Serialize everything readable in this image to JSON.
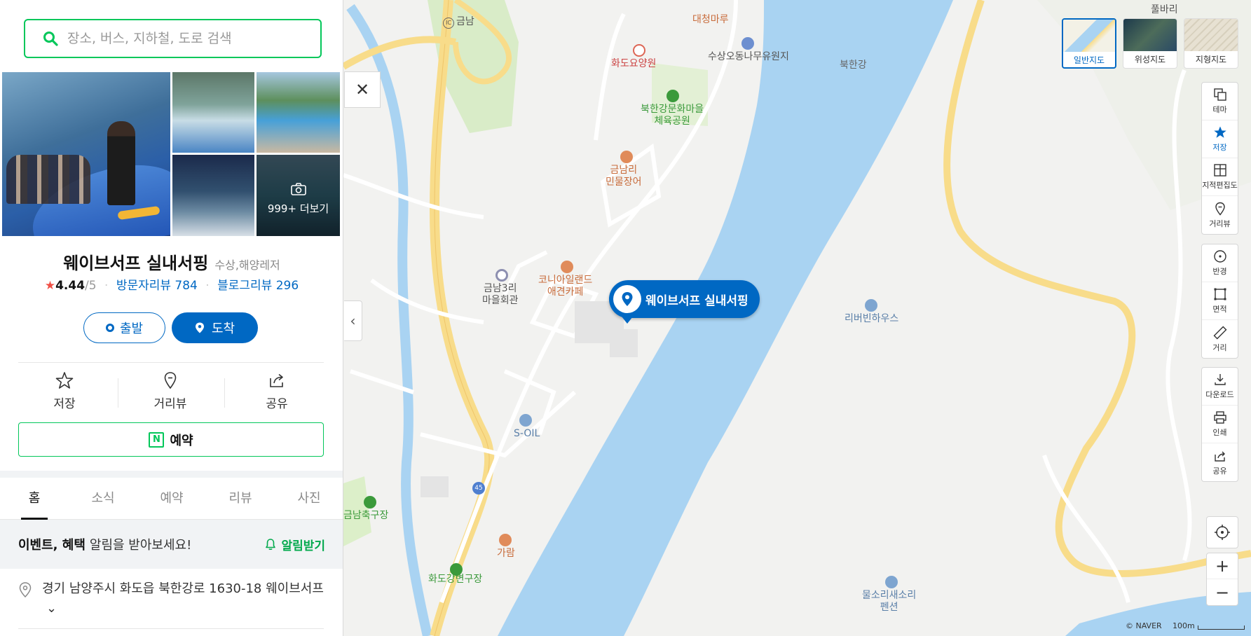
{
  "search": {
    "placeholder": "장소, 버스, 지하철, 도로 검색"
  },
  "photos": {
    "more_label": "999+ 더보기"
  },
  "place": {
    "name": "웨이브서프 실내서핑",
    "category": "수상,해양레저",
    "rating": "4.44",
    "rating_max": "/5",
    "visitor_review_label": "방문자리뷰",
    "visitor_review_count": "784",
    "blog_review_label": "블로그리뷰",
    "blog_review_count": "296"
  },
  "route": {
    "start_label": "출발",
    "arrive_label": "도착"
  },
  "actions": {
    "save": "저장",
    "street_view": "거리뷰",
    "share": "공유"
  },
  "reserve_label": "예약",
  "tabs": [
    {
      "label": "홈"
    },
    {
      "label": "소식"
    },
    {
      "label": "예약"
    },
    {
      "label": "리뷰"
    },
    {
      "label": "사진"
    }
  ],
  "notice": {
    "bold": "이벤트, 혜택",
    "rest": "알림을 받아보세요!",
    "button": "알림받기"
  },
  "address": {
    "text": "경기 남양주시 화도읍 북한강로 1630-18 웨이브서프"
  },
  "map": {
    "marker_label": "웨이브서프 실내서핑",
    "labels": {
      "geumnam_ic": "금남",
      "daecheong": "대청마루",
      "hwado_hosp": "화도요양원",
      "susang": "수상오동나무유원지",
      "bukhangang": "북한강",
      "culture_park": "북한강문화마을\n체육공원",
      "eel": "금남리\n민물장어",
      "hall": "금남3리\n마을회관",
      "cafe": "코니아일랜드\n애견카페",
      "riverbean": "리버빈하우스",
      "soil": "S-OIL",
      "route45": "45",
      "football": "금남축구장",
      "garam": "가람",
      "hwado_field": "화도강변구장",
      "pension": "물소리새소리\n펜션",
      "pulbari": "풀바리"
    },
    "map_types": [
      {
        "label": "일반지도",
        "active": true
      },
      {
        "label": "위성지도",
        "active": false
      },
      {
        "label": "지형지도",
        "active": false
      }
    ],
    "tools_a": [
      {
        "label": "테마",
        "icon": "theme-icon"
      },
      {
        "label": "저장",
        "icon": "star-icon"
      },
      {
        "label": "지적편집도",
        "icon": "cadastral-icon"
      },
      {
        "label": "거리뷰",
        "icon": "streetview-icon"
      }
    ],
    "tools_b": [
      {
        "label": "반경",
        "icon": "radius-icon"
      },
      {
        "label": "면적",
        "icon": "area-icon"
      },
      {
        "label": "거리",
        "icon": "ruler-icon"
      }
    ],
    "tools_c": [
      {
        "label": "다운로드",
        "icon": "download-icon"
      },
      {
        "label": "인쇄",
        "icon": "print-icon"
      },
      {
        "label": "공유",
        "icon": "share-icon"
      }
    ],
    "credit": "© NAVER",
    "scale_label": "100m"
  },
  "colors": {
    "naver_green": "#03c75a",
    "naver_blue": "#0068c3",
    "river": "#a9d3f2",
    "road": "#f8dc8a"
  }
}
